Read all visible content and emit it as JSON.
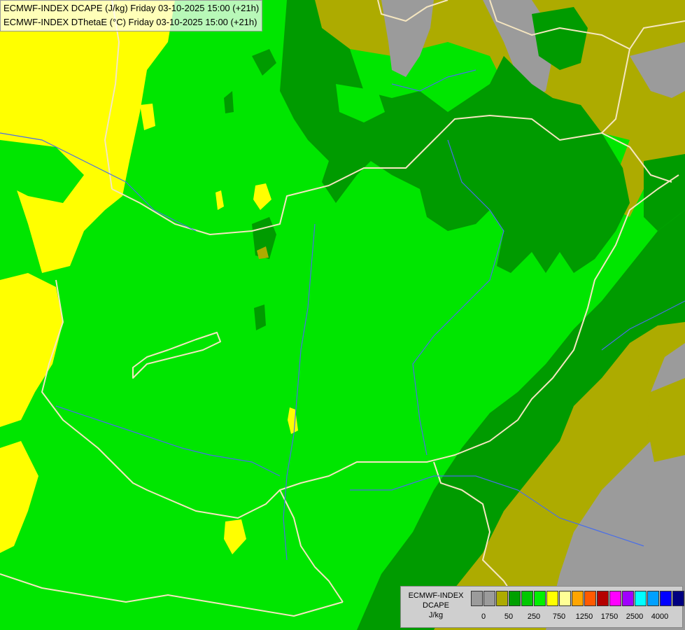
{
  "header": {
    "line1": "ECMWF-INDEX DCAPE (J/kg) Friday 03-10-2025 15:00 (+21h)",
    "line2": "ECMWF-INDEX DThetaE (°C) Friday 03-10-2025 15:00 (+21h)"
  },
  "legend": {
    "title1": "ECMWF-INDEX",
    "title2": "DCAPE",
    "unit": "J/kg",
    "colors": [
      "#9b9b9b",
      "#9b9b9b",
      "#adab00",
      "#00a000",
      "#00c800",
      "#00f000",
      "#ffff00",
      "#ffff96",
      "#ffa500",
      "#ff5a00",
      "#b40000",
      "#ff00ff",
      "#a000ff",
      "#00ffff",
      "#00a0ff",
      "#0000ff",
      "#000080"
    ],
    "ticks": [
      "0",
      "50",
      "250",
      "750",
      "1250",
      "1750",
      "2500",
      "4000"
    ]
  },
  "map_colors": {
    "bright_green": "#00e600",
    "dark_green": "#009b00",
    "olive": "#adab00",
    "gray": "#9b9b9b",
    "yellow": "#ffff00",
    "borders": "#f5e6c0",
    "rivers": "#4a6ee8"
  }
}
